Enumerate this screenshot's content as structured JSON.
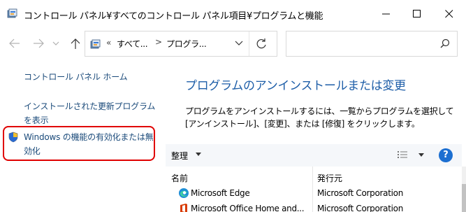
{
  "window": {
    "title": "コントロール パネル¥すべてのコントロール パネル項目¥プログラムと機能"
  },
  "address": {
    "crumb_prefix": "«",
    "crumb1": "すべて...",
    "separator": ">",
    "crumb2": "プログラ...",
    "search_placeholder": ""
  },
  "sidebar": {
    "items": [
      {
        "label": "コントロール パネル ホーム"
      },
      {
        "label": "インストールされた更新プログラムを表示"
      },
      {
        "label": "Windows の機能の有効化または無効化"
      }
    ]
  },
  "main": {
    "heading": "プログラムのアンインストールまたは変更",
    "description": "プログラムをアンインストールするには、一覧からプログラムを選択して [アンインストール]、[変更]、または [修復] をクリックします。",
    "toolbar": {
      "organize_label": "整理",
      "help_label": "?"
    },
    "columns": {
      "name": "名前",
      "publisher": "発行元"
    },
    "programs": [
      {
        "name": "Microsoft Edge",
        "publisher": "Microsoft Corporation",
        "icon": "edge-icon"
      },
      {
        "name": "Microsoft Office Home and...",
        "publisher": "Microsoft Corporation",
        "icon": "office-icon"
      }
    ]
  },
  "colors": {
    "link": "#1a4a7a",
    "heading": "#1e5ea8",
    "highlight": "#e00000",
    "help": "#1c6fd1"
  }
}
